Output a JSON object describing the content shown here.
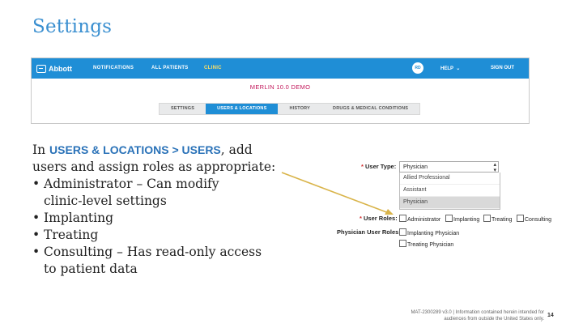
{
  "slide": {
    "title": "Settings",
    "page_number": "14"
  },
  "app": {
    "logo_text": "Abbott",
    "nav": [
      {
        "label": "NOTIFICATIONS"
      },
      {
        "label": "ALL PATIENTS"
      },
      {
        "label": "CLINIC"
      }
    ],
    "user_initials": "RD",
    "help_label": "HELP",
    "signout_label": "SIGN OUT",
    "demo_title": "MERLIN 10.0 DEMO",
    "tabs": [
      {
        "label": "SETTINGS"
      },
      {
        "label": "USERS & LOCATIONS"
      },
      {
        "label": "HISTORY"
      },
      {
        "label": "DRUGS & MEDICAL CONDITIONS"
      }
    ],
    "accent": "#1f8ed6"
  },
  "body": {
    "intro_prefix": "In ",
    "intro_highlight": "USERS & LOCATIONS > USERS",
    "intro_suffix": ", add",
    "intro_line2": "users and assign roles as appropriate:",
    "bullets": [
      {
        "line1": "Administrator – Can modify",
        "line2": "clinic-level settings"
      },
      {
        "line1": "Implanting"
      },
      {
        "line1": "Treating"
      },
      {
        "line1": "Consulting – Has read-only access",
        "line2": "to patient data"
      }
    ],
    "bullet_char": "•"
  },
  "form": {
    "user_type_label": "User Type:",
    "user_type_value": "Physician",
    "user_type_options": [
      "Allied Professional",
      "Assistant",
      "Physician"
    ],
    "user_roles_label": "User Roles:",
    "roles": [
      "Administrator",
      "Implanting",
      "Treating",
      "Consulting"
    ],
    "physician_roles_label": "Physician User Roles:",
    "physician_roles": [
      "Implanting Physician",
      "Treating Physician"
    ],
    "required_mark": "*"
  },
  "footer": {
    "line1": "MAT-2300289 v3.0 | Information contained herein intended for",
    "line2": "audiences from outside the United States only."
  }
}
